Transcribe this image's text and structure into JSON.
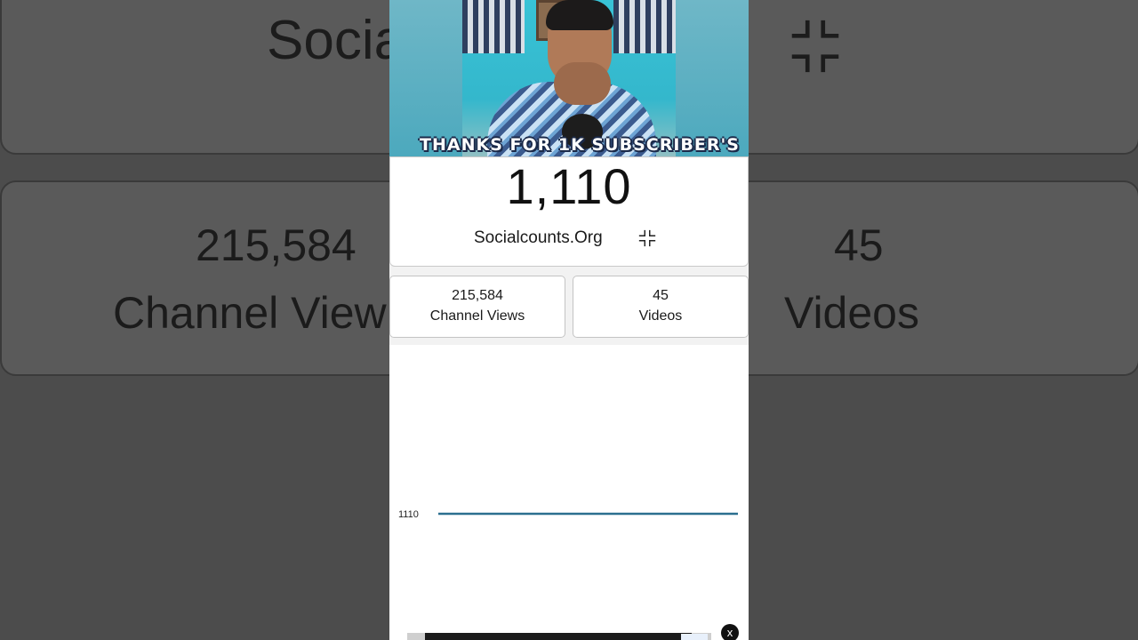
{
  "video": {
    "caption": "THANKS FOR 1K SUBSCRIBER'S"
  },
  "counter": {
    "subscribers": "1,110",
    "brand": "Socialcounts.Org",
    "shrink_icon": "exit-fullscreen-icon"
  },
  "stats": {
    "views_value": "215,584",
    "views_label": "Channel Views",
    "videos_value": "45",
    "videos_label": "Videos"
  },
  "background": {
    "brand_partial": "Socia",
    "views_value": "215,584",
    "views_label_partial": "Channel View",
    "videos_value": "45",
    "videos_label": "Videos"
  },
  "ad": {
    "close_label": "x"
  },
  "chart_data": {
    "type": "line",
    "series": [
      {
        "values": [
          1110,
          1110
        ]
      }
    ],
    "y_tick_labels": [
      "1110"
    ],
    "color": "#2b6f8f"
  }
}
